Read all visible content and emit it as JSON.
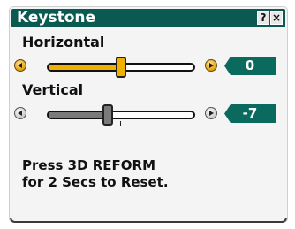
{
  "window": {
    "title": "Keystone",
    "help_label": "?",
    "close_label": "×"
  },
  "horizontal": {
    "label": "Horizontal",
    "value": "0",
    "level": 0.5,
    "color": "#f0b000",
    "left_icon": "arrow-left-icon",
    "right_icon": "arrow-right-icon"
  },
  "vertical": {
    "label": "Vertical",
    "value": "-7",
    "level": 0.41,
    "color": "#7a7a7a",
    "left_icon": "arrow-left-icon",
    "right_icon": "arrow-right-icon"
  },
  "message": {
    "line1": "Press 3D REFORM",
    "line2": "for 2 Secs to Reset."
  }
}
